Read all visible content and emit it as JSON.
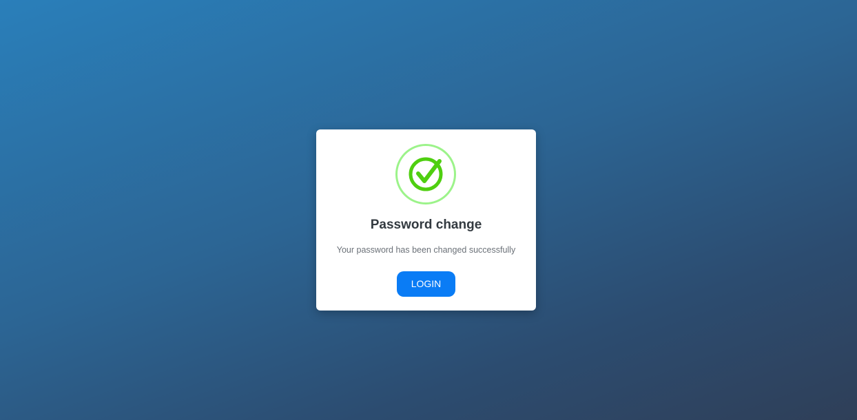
{
  "dialog": {
    "title": "Password change",
    "message": "Your password has been changed successfully",
    "login_label": "LOGIN",
    "icon": "check-circle-icon"
  },
  "colors": {
    "accent": "#0a7cf5",
    "success_ring": "#9cf38a",
    "success_check": "#4fcf10",
    "title": "#333a40",
    "message": "#6b7178"
  }
}
